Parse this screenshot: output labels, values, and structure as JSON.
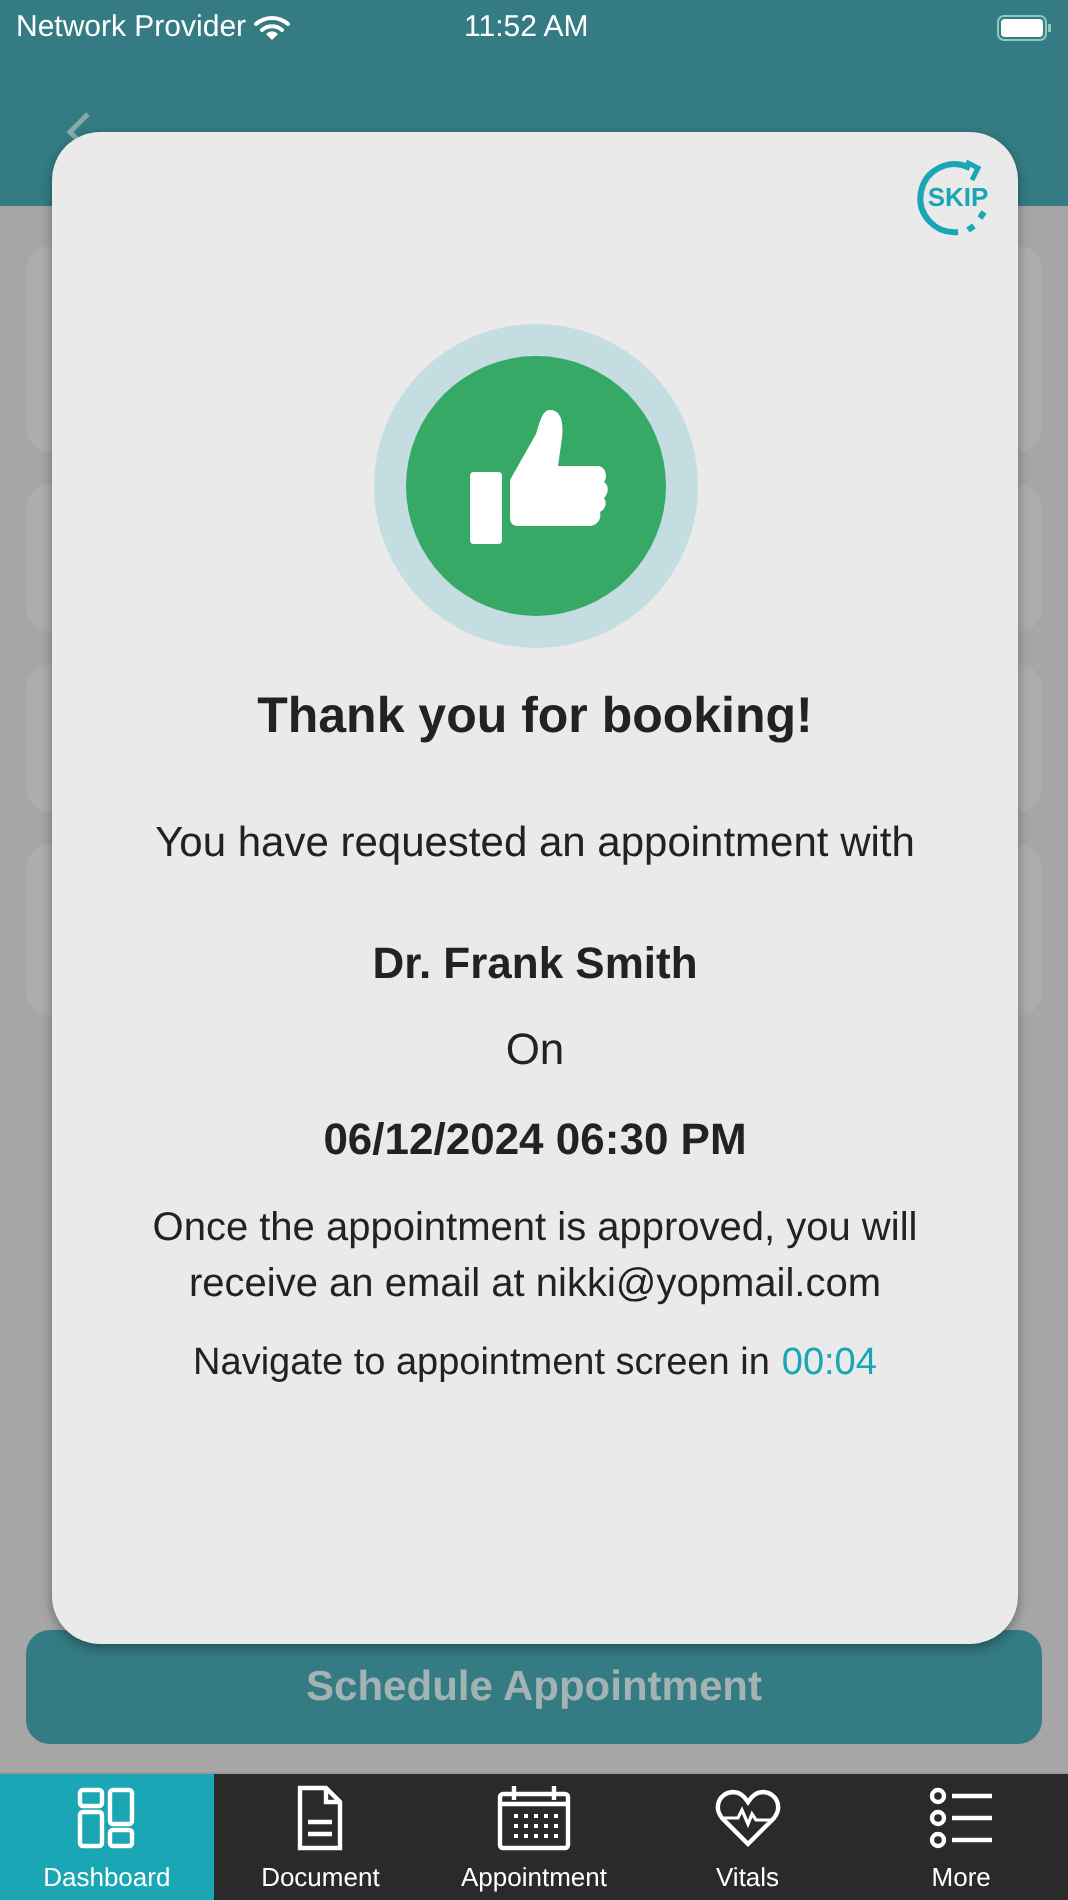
{
  "status_bar": {
    "carrier": "Network Provider",
    "time": "11:52 AM"
  },
  "background_cards": [
    {
      "kind": "tall"
    },
    {
      "kind": "short"
    },
    {
      "kind": "short"
    },
    {
      "kind": "medium"
    }
  ],
  "schedule_button": "Schedule Appointment",
  "modal": {
    "skip": "SKIP",
    "title": "Thank you for booking!",
    "message": "You have requested an appointment with",
    "doctor": "Dr. Frank Smith",
    "on": "On",
    "datetime": "06/12/2024 06:30 PM",
    "email_note": "Once the appointment is approved, you will receive an email at nikki@yopmail.com",
    "navigate_text": "Navigate to appointment screen in",
    "countdown": "00:04"
  },
  "tabs": [
    {
      "label": "Dashboard",
      "kind": "dashboard",
      "selected": true
    },
    {
      "label": "Document",
      "kind": "document",
      "selected": false
    },
    {
      "label": "Appointment",
      "kind": "calendar",
      "selected": false
    },
    {
      "label": "Vitals",
      "kind": "vitals",
      "selected": false
    },
    {
      "label": "More",
      "kind": "list",
      "selected": false
    }
  ]
}
